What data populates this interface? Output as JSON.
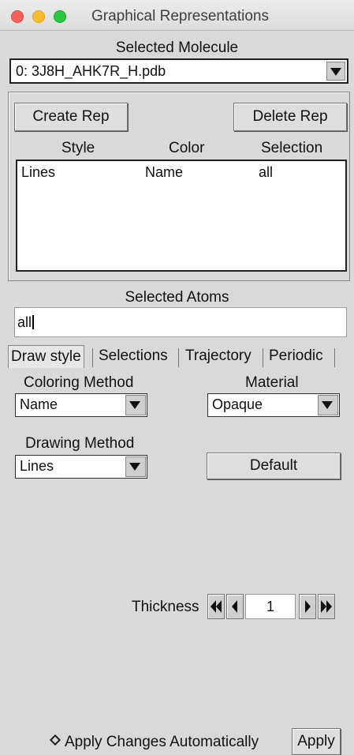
{
  "window": {
    "title": "Graphical Representations"
  },
  "molecule": {
    "label": "Selected Molecule",
    "selected": "0: 3J8H_AHK7R_H.pdb"
  },
  "reps": {
    "create_label": "Create Rep",
    "delete_label": "Delete Rep",
    "columns": [
      "Style",
      "Color",
      "Selection"
    ],
    "rows": [
      {
        "style": "Lines",
        "color": "Name",
        "selection": "all"
      }
    ]
  },
  "atoms": {
    "label": "Selected Atoms",
    "value": "all"
  },
  "tabs": [
    "Draw style",
    "Selections",
    "Trajectory",
    "Periodic"
  ],
  "draw": {
    "coloring_label": "Coloring Method",
    "coloring_value": "Name",
    "material_label": "Material",
    "material_value": "Opaque",
    "drawing_label": "Drawing Method",
    "drawing_value": "Lines",
    "default_label": "Default",
    "thickness_label": "Thickness",
    "thickness_value": "1"
  },
  "footer": {
    "auto_label": "Apply Changes Automatically",
    "apply_label": "Apply"
  }
}
